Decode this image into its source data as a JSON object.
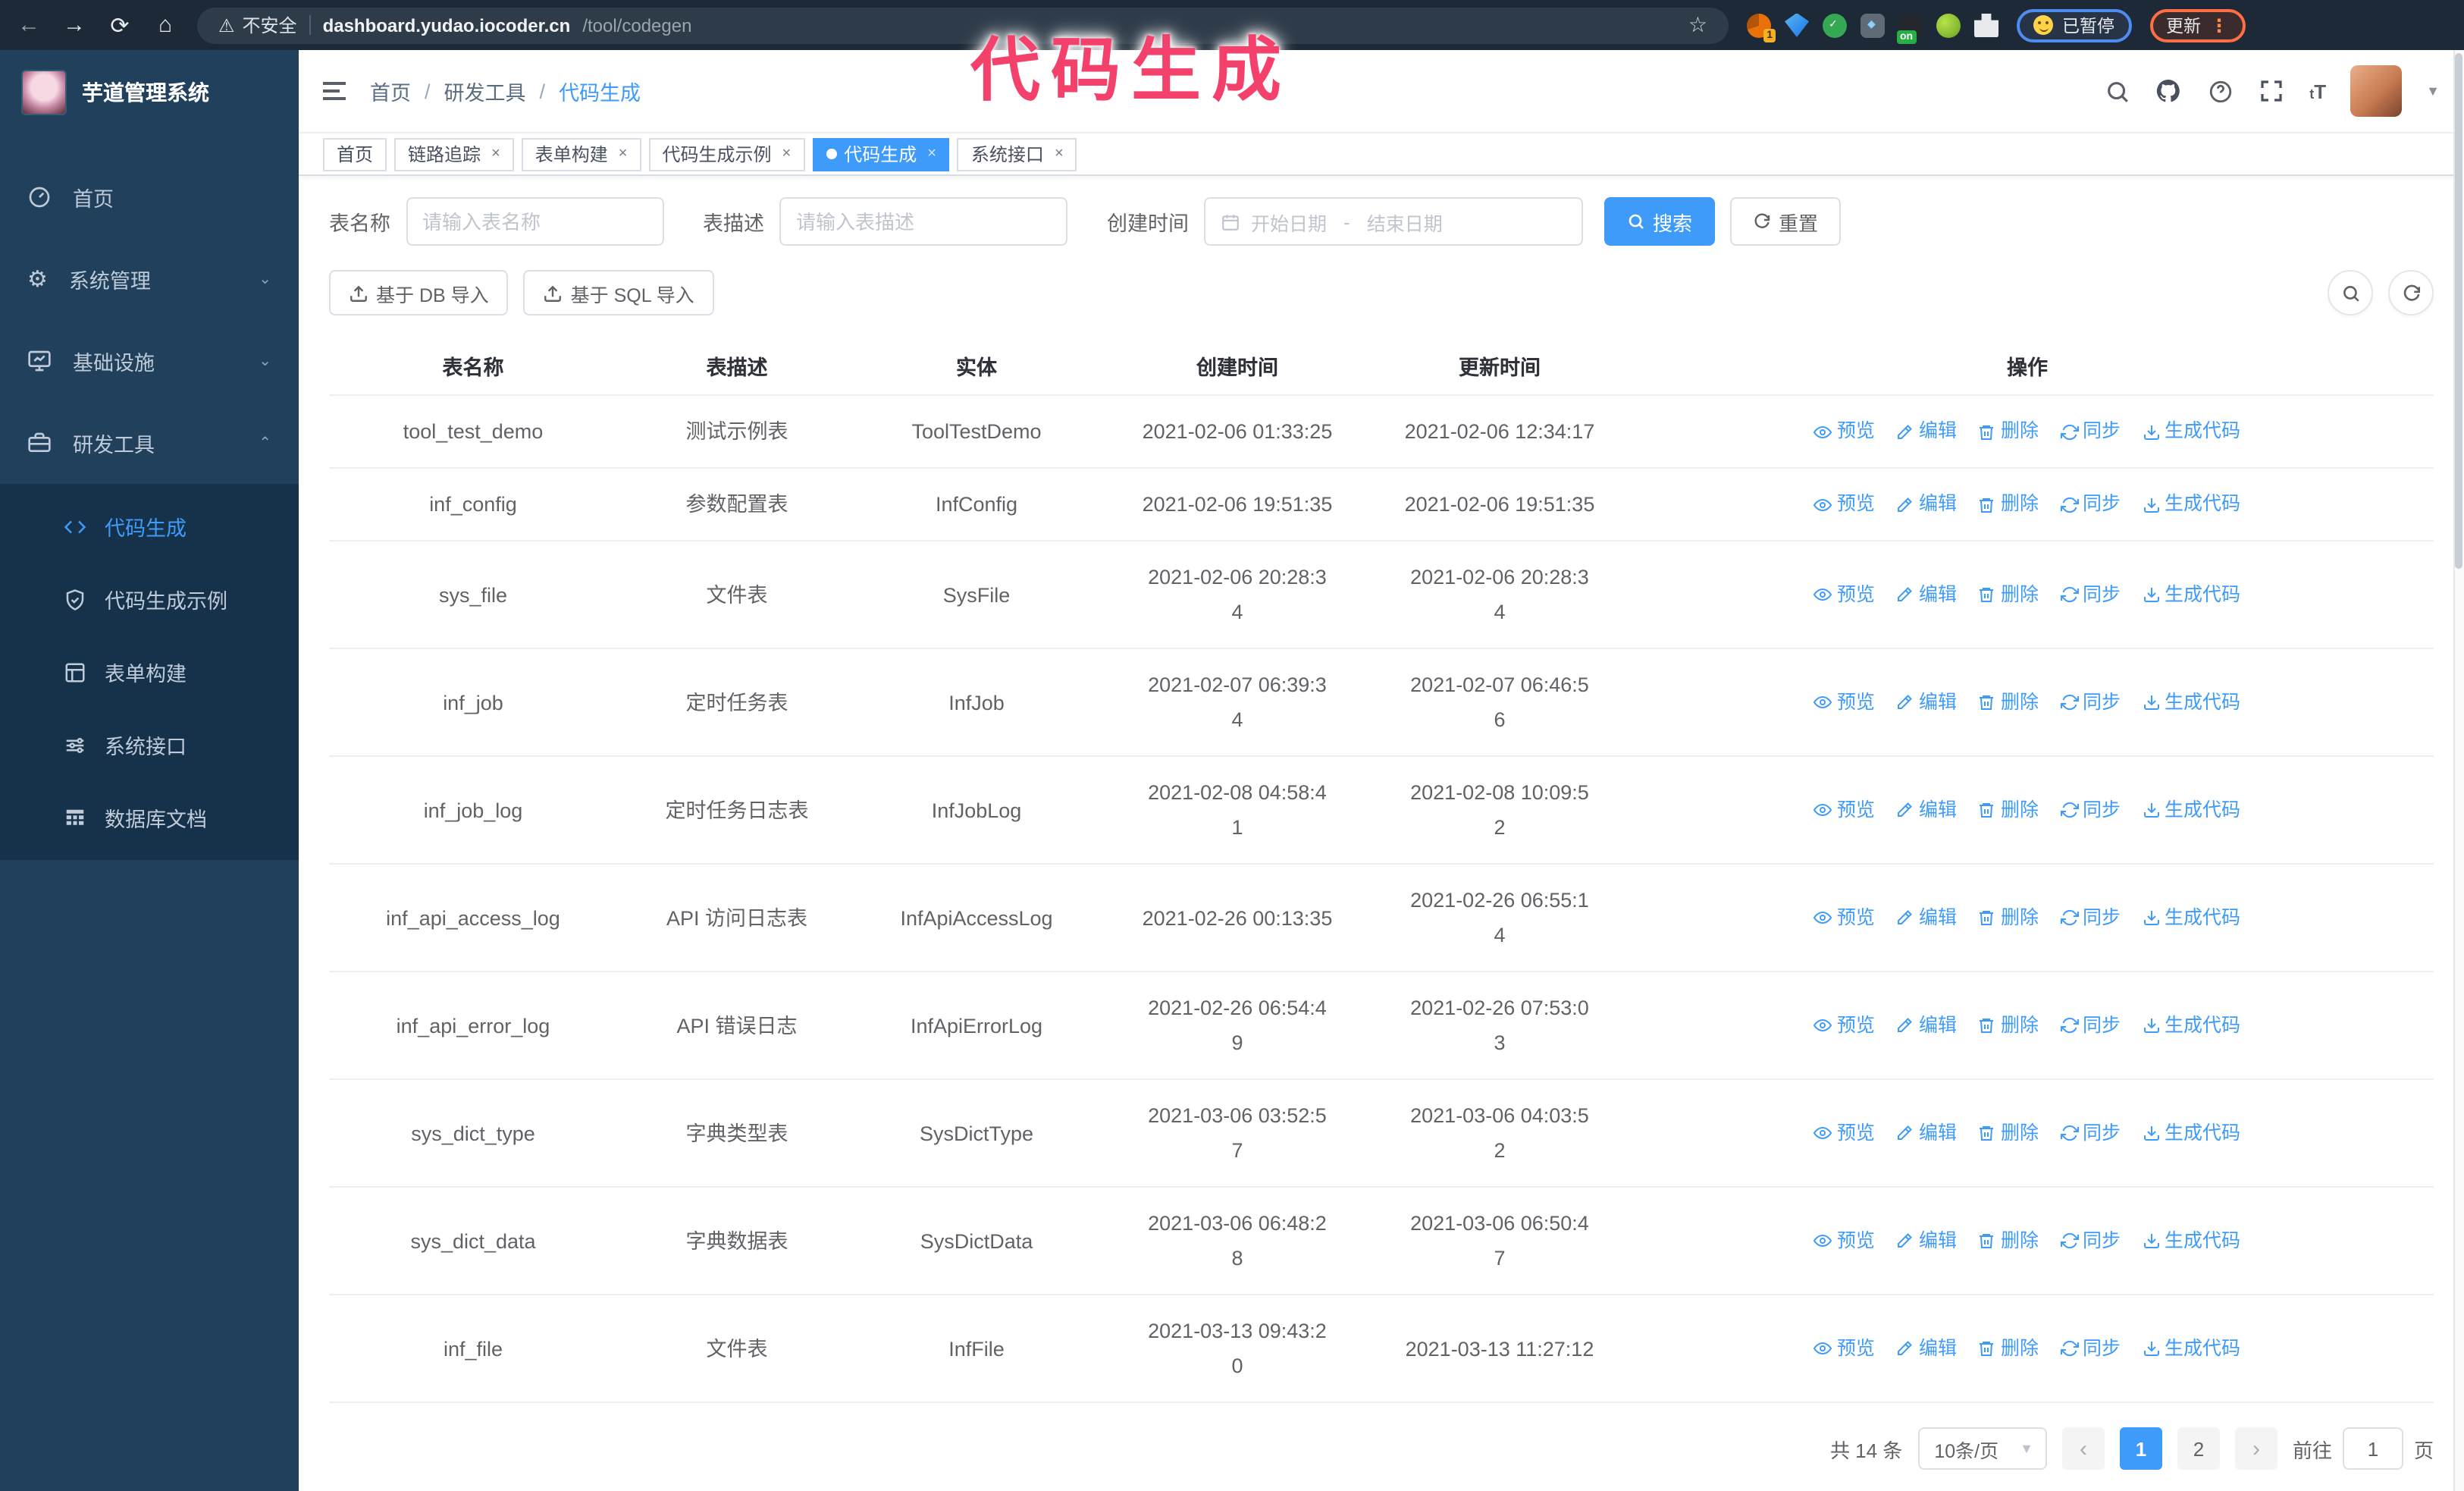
{
  "annotation": {
    "caption": "代码生成"
  },
  "browser": {
    "back_icon": "←",
    "forward_icon": "→",
    "reload_icon": "⟳",
    "home_icon": "⌂",
    "security_warning_icon": "⚠",
    "security_label": "不安全",
    "url_host": "dashboard.yudao.iocoder.cn",
    "url_path": "/tool/codegen",
    "bookmark_icon": "☆",
    "paused_badge": "已暂停",
    "update_button": "更新",
    "menu_dots_icon": "⋮",
    "extension_badge": "1",
    "extension_on_label": "on"
  },
  "sidebar": {
    "app_title": "芋道管理系统",
    "menu": [
      {
        "label": "首页"
      },
      {
        "label": "系统管理",
        "chevron": "⌄"
      },
      {
        "label": "基础设施",
        "chevron": "⌄"
      },
      {
        "label": "研发工具",
        "chevron": "⌃"
      }
    ],
    "submenu": [
      {
        "label": "代码生成",
        "active": true
      },
      {
        "label": "代码生成示例"
      },
      {
        "label": "表单构建"
      },
      {
        "label": "系统接口"
      },
      {
        "label": "数据库文档"
      }
    ],
    "gear_glyph": "⚙"
  },
  "header": {
    "breadcrumb": {
      "items": [
        "首页",
        "研发工具",
        "代码生成"
      ],
      "separator": "/"
    },
    "tabs": [
      {
        "label": "首页"
      },
      {
        "label": "链路追踪",
        "close": "×"
      },
      {
        "label": "表单构建",
        "close": "×"
      },
      {
        "label": "代码生成示例",
        "close": "×"
      },
      {
        "label": "代码生成",
        "close": "×",
        "active": true
      },
      {
        "label": "系统接口",
        "close": "×"
      }
    ],
    "tab_close_icon": "×"
  },
  "filters": {
    "table_name_label": "表名称",
    "table_name_placeholder": "请输入表名称",
    "table_desc_label": "表描述",
    "table_desc_placeholder": "请输入表描述",
    "create_time_label": "创建时间",
    "date_start_placeholder": "开始日期",
    "date_separator": "-",
    "date_end_placeholder": "结束日期",
    "search_button": "搜索",
    "reset_button": "重置"
  },
  "toolbar": {
    "import_db_button": "基于 DB 导入",
    "import_sql_button": "基于 SQL 导入"
  },
  "table": {
    "columns": [
      "表名称",
      "表描述",
      "实体",
      "创建时间",
      "更新时间",
      "操作"
    ],
    "actions": [
      "预览",
      "编辑",
      "删除",
      "同步",
      "生成代码"
    ],
    "rows": [
      {
        "name": "tool_test_demo",
        "desc": "测试示例表",
        "entity": "ToolTestDemo",
        "created": "2021-02-06 01:33:25",
        "updated": "2021-02-06 12:34:17"
      },
      {
        "name": "inf_config",
        "desc": "参数配置表",
        "entity": "InfConfig",
        "created": "2021-02-06 19:51:35",
        "updated": "2021-02-06 19:51:35"
      },
      {
        "name": "sys_file",
        "desc": "文件表",
        "entity": "SysFile",
        "created": "2021-02-06 20:28:3\n4",
        "updated": "2021-02-06 20:28:3\n4"
      },
      {
        "name": "inf_job",
        "desc": "定时任务表",
        "entity": "InfJob",
        "created": "2021-02-07 06:39:3\n4",
        "updated": "2021-02-07 06:46:5\n6"
      },
      {
        "name": "inf_job_log",
        "desc": "定时任务日志表",
        "entity": "InfJobLog",
        "created": "2021-02-08 04:58:4\n1",
        "updated": "2021-02-08 10:09:5\n2"
      },
      {
        "name": "inf_api_access_log",
        "desc": "API 访问日志表",
        "entity": "InfApiAccessLog",
        "created": "2021-02-26 00:13:35",
        "updated": "2021-02-26 06:55:1\n4"
      },
      {
        "name": "inf_api_error_log",
        "desc": "API 错误日志",
        "entity": "InfApiErrorLog",
        "created": "2021-02-26 06:54:4\n9",
        "updated": "2021-02-26 07:53:0\n3"
      },
      {
        "name": "sys_dict_type",
        "desc": "字典类型表",
        "entity": "SysDictType",
        "created": "2021-03-06 03:52:5\n7",
        "updated": "2021-03-06 04:03:5\n2"
      },
      {
        "name": "sys_dict_data",
        "desc": "字典数据表",
        "entity": "SysDictData",
        "created": "2021-03-06 06:48:2\n8",
        "updated": "2021-03-06 06:50:4\n7"
      },
      {
        "name": "inf_file",
        "desc": "文件表",
        "entity": "InfFile",
        "created": "2021-03-13 09:43:2\n0",
        "updated": "2021-03-13 11:27:12"
      }
    ]
  },
  "pagination": {
    "total": "共 14 条",
    "page_size": "10条/页",
    "prev_icon": "‹",
    "next_icon": "›",
    "pages": [
      "1",
      "2"
    ],
    "active_page": "1",
    "goto_label": "前往",
    "goto_value": "1",
    "goto_suffix": "页"
  },
  "colors": {
    "primary": "#3f9bfa",
    "annotation_pink": "#f4416b",
    "sidebar_bg": "#20405c",
    "submenu_bg": "#16324b"
  }
}
